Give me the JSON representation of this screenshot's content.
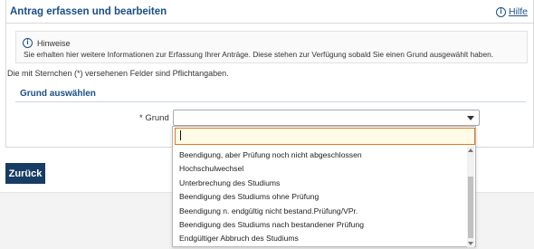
{
  "panel": {
    "title": "Antrag erfassen und bearbeiten",
    "help_label": "Hilfe",
    "help_icon": "info-icon"
  },
  "hints": {
    "heading": "Hinweise",
    "text": "Sie erhalten hier weitere Informationen zur Erfassung Ihrer Anträge. Diese stehen zur Verfügung sobald Sie einen Grund ausgewählt haben."
  },
  "required_note": "Die mit Sternchen (*) versehenen Felder sind Pflichtangaben.",
  "section": {
    "title": "Grund auswählen"
  },
  "field": {
    "label": "* Grund",
    "selected_value": "",
    "search_value": ""
  },
  "dropdown": {
    "options": [
      "Beendigung, aber Prüfung noch nicht abgeschlossen",
      "Hochschulwechsel",
      "Unterbrechung des Studiums",
      "Beendigung des Studiums ohne Prüfung",
      "Beendigung n. endgültig nicht bestand.Prüfung/VPr.",
      "Beendigung des Studiums nach bestandener Prüfung",
      "Endgültiger Abbruch des Studiums"
    ]
  },
  "actions": {
    "back_label": "Zurück"
  },
  "colors": {
    "accent": "#1a4f86",
    "button": "#173d64",
    "focus": "#e07a22"
  }
}
